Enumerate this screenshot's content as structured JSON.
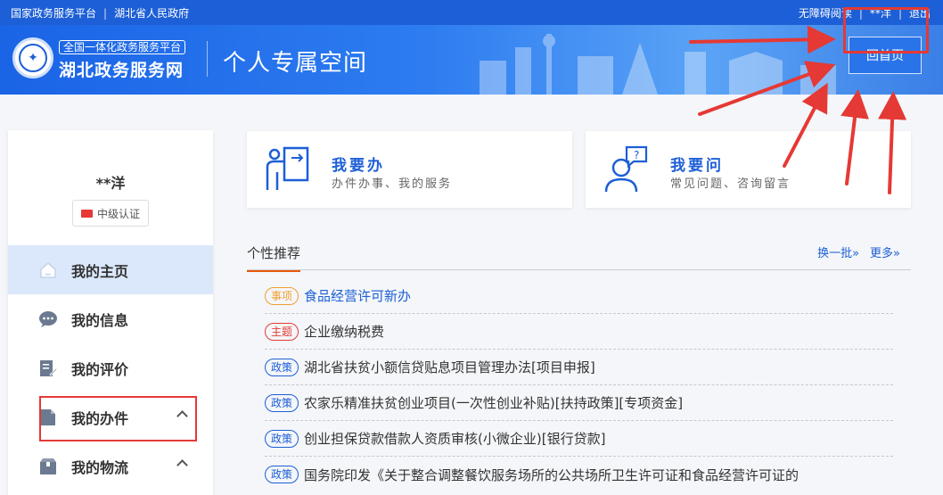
{
  "topbar": {
    "left_links": [
      "国家政务服务平台",
      "湖北省人民政府"
    ],
    "right_links": [
      "无障碍阅读",
      "**洋",
      "退出"
    ]
  },
  "header": {
    "logo_badge": "全国一体化政务服务平台",
    "logo_name": "湖北政务服务网",
    "page_title": "个人专属空间",
    "home_button": "回首页"
  },
  "sidebar": {
    "user_name": "**洋",
    "cert_label": "中级认证",
    "items": [
      {
        "label": "我的主页",
        "icon": "home-icon",
        "active": true
      },
      {
        "label": "我的信息",
        "icon": "chat-icon",
        "active": false
      },
      {
        "label": "我的评价",
        "icon": "edit-icon",
        "active": false
      },
      {
        "label": "我的办件",
        "icon": "document-icon",
        "active": false
      },
      {
        "label": "我的物流",
        "icon": "package-icon",
        "active": false
      }
    ]
  },
  "cards": [
    {
      "title": "我要办",
      "subtitle": "办件办事、我的服务",
      "icon": "handle-affairs-icon"
    },
    {
      "title": "我要问",
      "subtitle": "常见问题、咨询留言",
      "icon": "ask-question-icon"
    }
  ],
  "recommend": {
    "tab": "个性推荐",
    "swap": "换一批»",
    "more": "更多»",
    "items": [
      {
        "tag": "事项",
        "color": "orange",
        "text": "食品经营许可新办"
      },
      {
        "tag": "主题",
        "color": "red",
        "text": "企业缴纳税费"
      },
      {
        "tag": "政策",
        "color": "blue",
        "text": "湖北省扶贫小额信贷贴息项目管理办法[项目申报]"
      },
      {
        "tag": "政策",
        "color": "blue",
        "text": "农家乐精准扶贫创业项目(一次性创业补贴)[扶持政策][专项资金]"
      },
      {
        "tag": "政策",
        "color": "blue",
        "text": "创业担保贷款借款人资质审核(小微企业)[银行贷款]"
      },
      {
        "tag": "政策",
        "color": "blue",
        "text": "国务院印发《关于整合调整餐饮服务场所的公共场所卫生许可证和食品经营许可证的"
      }
    ]
  },
  "colors": {
    "primary": "#1d5fd6",
    "annotation": "#e53935",
    "tab_underline": "#e8590c"
  }
}
